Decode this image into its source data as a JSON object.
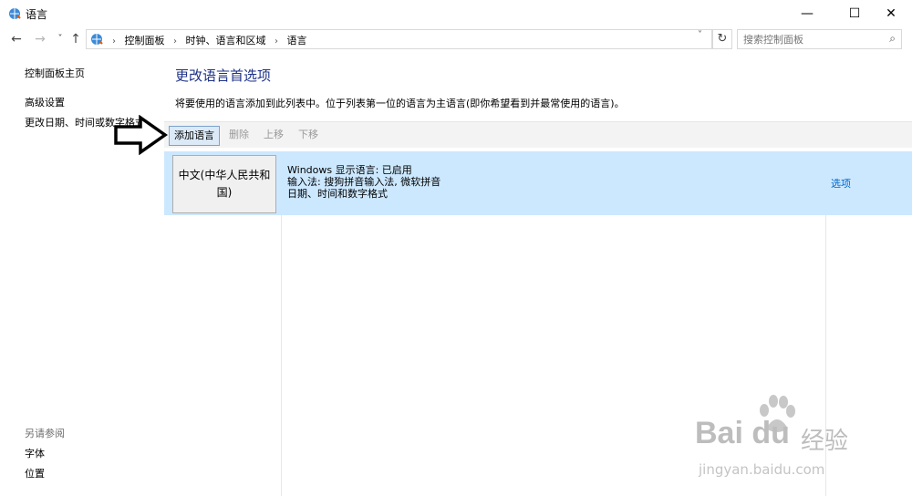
{
  "window": {
    "title": "语言",
    "minimize_glyph": "—",
    "maximize_glyph": "☐",
    "close_glyph": "✕"
  },
  "nav": {
    "back_glyph": "←",
    "forward_glyph": "→",
    "history_glyph": "˅",
    "up_glyph": "↑",
    "breadcrumbs": [
      "控制面板",
      "时钟、语言和区域",
      "语言"
    ],
    "separator": "›",
    "dropdown_glyph": "˅",
    "refresh_glyph": "↻",
    "search_placeholder": "搜索控制面板",
    "search_glyph": "⌕"
  },
  "sidebar": {
    "home": "控制面板主页",
    "advanced": "高级设置",
    "change_date": "更改日期、时间或数字格式",
    "see_also_heading": "另请参阅",
    "fonts": "字体",
    "location": "位置"
  },
  "main": {
    "title": "更改语言首选项",
    "description": "将要使用的语言添加到此列表中。位于列表第一位的语言为主语言(即你希望看到并最常使用的语言)。"
  },
  "toolbar": {
    "add": "添加语言",
    "remove": "删除",
    "move_up": "上移",
    "move_down": "下移"
  },
  "languages": [
    {
      "name": "中文(中华人民共和国)",
      "display": "Windows 显示语言: 已启用",
      "input": "输入法: 搜狗拼音输入法, 微软拼音",
      "format": "日期、时间和数字格式",
      "options": "选项"
    }
  ],
  "watermark": {
    "logo": "Bai du",
    "cn": "经验",
    "url": "jingyan.baidu.com"
  },
  "colors": {
    "selection": "#cce8ff",
    "title_blue": "#1e3287",
    "link_blue": "#0066cc"
  }
}
